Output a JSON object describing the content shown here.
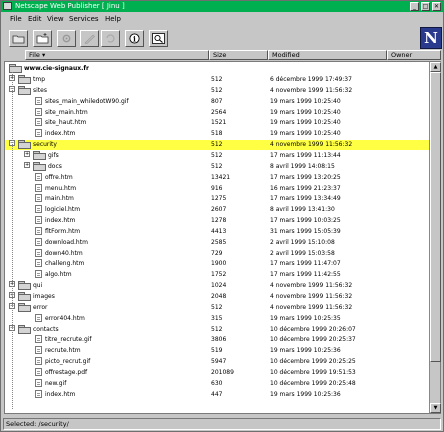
{
  "window": {
    "title": "Netscape Web Publisher [ Jinu ]",
    "min_label": "_",
    "max_label": "□",
    "close_label": "✕"
  },
  "menu": [
    "File",
    "Edit",
    "View",
    "Services",
    "Help"
  ],
  "toolbar": {
    "buttons": [
      "open-folder",
      "new-folder",
      "gear",
      "edit",
      "refresh",
      "info",
      "find"
    ],
    "info_glyph": "i",
    "logo_letter": "N"
  },
  "columns": {
    "file": "File ▾",
    "size": "Size",
    "modified": "Modified",
    "owner": "Owner"
  },
  "root": "www.cie-signaux.fr",
  "rows": [
    {
      "name": "tmp",
      "size": "512",
      "modified": "6 décembre 1999 17:49:37",
      "type": "folder",
      "depth": 0,
      "expanded": false
    },
    {
      "name": "sites",
      "size": "512",
      "modified": "4 novembre 1999 11:56:32",
      "type": "folder",
      "depth": 0,
      "expanded": true
    },
    {
      "name": "sites_main_whiledotW90.gif",
      "size": "807",
      "modified": "19 mars 1999 10:25:40",
      "type": "file",
      "depth": 1
    },
    {
      "name": "site_main.htm",
      "size": "2564",
      "modified": "19 mars 1999 10:25:40",
      "type": "file",
      "depth": 1
    },
    {
      "name": "site_haut.htm",
      "size": "1521",
      "modified": "19 mars 1999 10:25:40",
      "type": "file",
      "depth": 1
    },
    {
      "name": "index.htm",
      "size": "518",
      "modified": "19 mars 1999 10:25:40",
      "type": "file",
      "depth": 1
    },
    {
      "name": "security",
      "size": "512",
      "modified": "4 novembre 1999 11:56:32",
      "type": "folder",
      "depth": 0,
      "expanded": true,
      "selected": true
    },
    {
      "name": "gifs",
      "size": "512",
      "modified": "17 mars 1999 11:13:44",
      "type": "folder",
      "depth": 1,
      "expanded": false
    },
    {
      "name": "docs",
      "size": "512",
      "modified": "8 avril 1999 14:08:15",
      "type": "folder",
      "depth": 1,
      "expanded": false
    },
    {
      "name": "offre.htm",
      "size": "13421",
      "modified": "17 mars 1999 13:20:25",
      "type": "file",
      "depth": 1
    },
    {
      "name": "menu.htm",
      "size": "916",
      "modified": "16 mars 1999 21:23:37",
      "type": "file",
      "depth": 1
    },
    {
      "name": "main.htm",
      "size": "1275",
      "modified": "17 mars 1999 13:34:49",
      "type": "file",
      "depth": 1
    },
    {
      "name": "logiciel.htm",
      "size": "2607",
      "modified": "8 avril 1999 13:41:30",
      "type": "file",
      "depth": 1
    },
    {
      "name": "index.htm",
      "size": "1278",
      "modified": "17 mars 1999 10:03:25",
      "type": "file",
      "depth": 1
    },
    {
      "name": "fltForm.htm",
      "size": "4413",
      "modified": "31 mars 1999 15:05:39",
      "type": "file",
      "depth": 1
    },
    {
      "name": "download.htm",
      "size": "2585",
      "modified": "2 avril 1999 15:10:08",
      "type": "file",
      "depth": 1
    },
    {
      "name": "down40.htm",
      "size": "729",
      "modified": "2 avril 1999 15:03:58",
      "type": "file",
      "depth": 1
    },
    {
      "name": "challeng.htm",
      "size": "1900",
      "modified": "17 mars 1999 11:47:07",
      "type": "file",
      "depth": 1
    },
    {
      "name": "algo.htm",
      "size": "1752",
      "modified": "17 mars 1999 11:42:55",
      "type": "file",
      "depth": 1
    },
    {
      "name": "qui",
      "size": "1024",
      "modified": "4 novembre 1999 11:56:32",
      "type": "folder",
      "depth": 0,
      "expanded": false
    },
    {
      "name": "images",
      "size": "2048",
      "modified": "4 novembre 1999 11:56:32",
      "type": "folder",
      "depth": 0,
      "expanded": false
    },
    {
      "name": "error",
      "size": "512",
      "modified": "4 novembre 1999 11:56:32",
      "type": "folder",
      "depth": 0,
      "expanded": true
    },
    {
      "name": "error404.htm",
      "size": "315",
      "modified": "19 mars 1999 10:25:35",
      "type": "file",
      "depth": 1
    },
    {
      "name": "contacts",
      "size": "512",
      "modified": "10 décembre 1999 20:26:07",
      "type": "folder",
      "depth": 0,
      "expanded": true
    },
    {
      "name": "titre_recrute.gif",
      "size": "3806",
      "modified": "10 décembre 1999 20:25:37",
      "type": "file",
      "depth": 1
    },
    {
      "name": "recrute.htm",
      "size": "519",
      "modified": "19 mars 1999 10:25:36",
      "type": "file",
      "depth": 1
    },
    {
      "name": "picto_recrut.gif",
      "size": "5947",
      "modified": "10 décembre 1999 20:25:25",
      "type": "file",
      "depth": 1
    },
    {
      "name": "offrestage.pdf",
      "size": "201089",
      "modified": "10 décembre 1999 19:51:53",
      "type": "file",
      "depth": 1
    },
    {
      "name": "new.gif",
      "size": "630",
      "modified": "10 décembre 1999 20:25:48",
      "type": "file",
      "depth": 1
    },
    {
      "name": "index.htm",
      "size": "447",
      "modified": "19 mars 1999 10:25:36",
      "type": "file",
      "depth": 1
    }
  ],
  "status": "Selected: /security/",
  "colors": {
    "titlebar": "#00b050",
    "selection": "#ffff44",
    "chrome": "#c6c6c6",
    "logo": "#2a3a8c"
  }
}
